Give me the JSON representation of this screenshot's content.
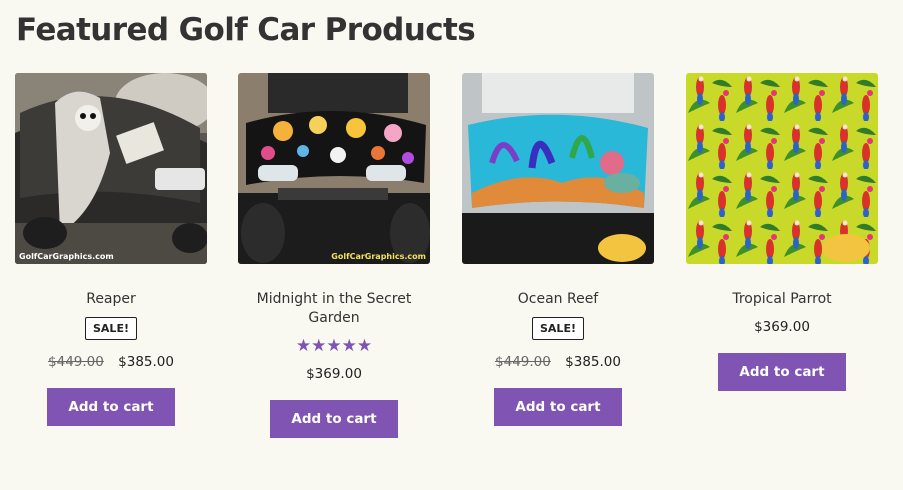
{
  "section_title": "Featured Golf Car Products",
  "colors": {
    "accent": "#7f54b3",
    "background": "#f9f8f1"
  },
  "products": [
    {
      "name": "Reaper",
      "sale_badge": "SALE!",
      "old_price": "$449.00",
      "price": "$385.00",
      "button": "Add to cart",
      "image_icon": "reaper-golf-cart-image",
      "watermark": "GolfCarGraphics.com"
    },
    {
      "name": "Midnight in the Secret Garden",
      "rating": 5,
      "rating_display": "★★★★★",
      "price": "$369.00",
      "button": "Add to cart",
      "image_icon": "floral-golf-cart-image",
      "watermark": "GolfCarGraphics.com"
    },
    {
      "name": "Ocean Reef",
      "sale_badge": "SALE!",
      "old_price": "$449.00",
      "price": "$385.00",
      "button": "Add to cart",
      "image_icon": "ocean-reef-golf-cart-image"
    },
    {
      "name": "Tropical Parrot",
      "price": "$369.00",
      "button": "Add to cart",
      "image_icon": "tropical-parrot-pattern-image"
    }
  ]
}
